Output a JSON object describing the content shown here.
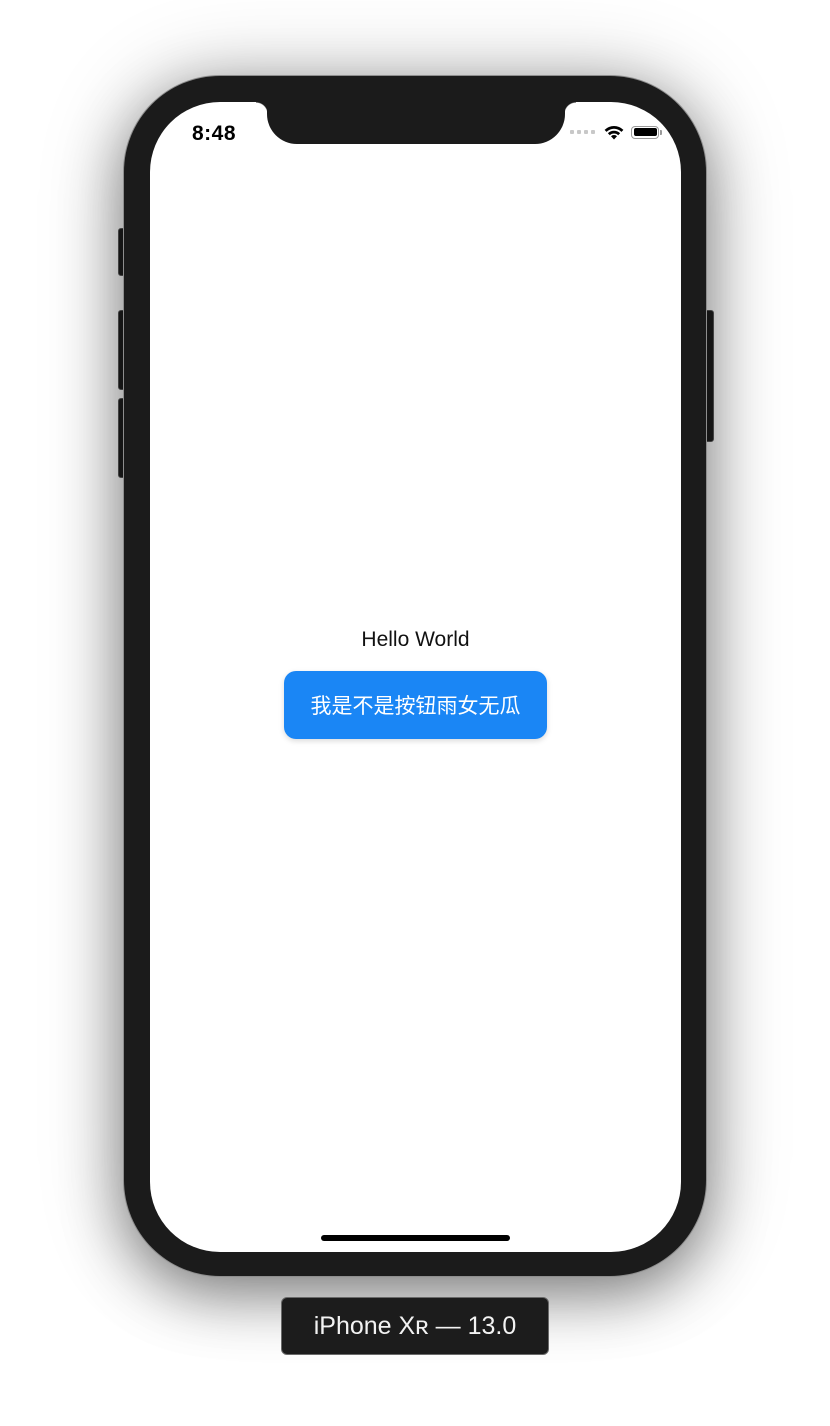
{
  "status_bar": {
    "time": "8:48",
    "icons": [
      "signal-dots-icon",
      "wifi-icon",
      "battery-icon"
    ]
  },
  "content": {
    "label_text": "Hello World",
    "button_text": "我是不是按钮雨女无瓜"
  },
  "device_caption": "iPhone Xʀ — 13.0",
  "colors": {
    "button_bg": "#1a86f5",
    "button_text": "#ffffff",
    "phone_frame": "#1b1b1b",
    "screen_bg": "#ffffff"
  }
}
